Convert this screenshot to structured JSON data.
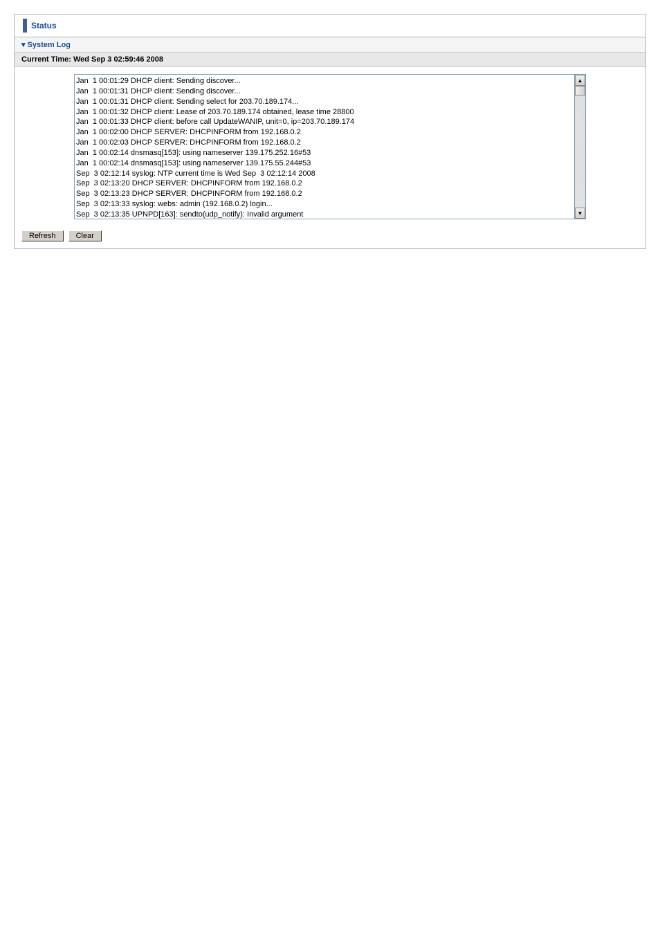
{
  "header": {
    "title": "Status"
  },
  "section": {
    "system_log_label": "System Log",
    "current_time_label": "Current Time:",
    "current_time_value": "Wed Sep 3 02:59:46 2008"
  },
  "log_lines": [
    "Jan  1 00:01:29 DHCP client: Sending discover...",
    "Jan  1 00:01:31 DHCP client: Sending discover...",
    "Jan  1 00:01:31 DHCP client: Sending select for 203.70.189.174...",
    "Jan  1 00:01:32 DHCP client: Lease of 203.70.189.174 obtained, lease time 28800",
    "Jan  1 00:01:33 DHCP client: before call UpdateWANIP, unit=0, ip=203.70.189.174",
    "Jan  1 00:02:00 DHCP SERVER: DHCPINFORM from 192.168.0.2",
    "Jan  1 00:02:03 DHCP SERVER: DHCPINFORM from 192.168.0.2",
    "Jan  1 00:02:14 dnsmasq[153]: using nameserver 139.175.252.16#53",
    "Jan  1 00:02:14 dnsmasq[153]: using nameserver 139.175.55.244#53",
    "Sep  3 02:12:14 syslog: NTP current time is Wed Sep  3 02:12:14 2008",
    "Sep  3 02:13:20 DHCP SERVER: DHCPINFORM from 192.168.0.2",
    "Sep  3 02:13:23 DHCP SERVER: DHCPINFORM from 192.168.0.2",
    "Sep  3 02:13:33 syslog: webs: admin (192.168.0.2) login...",
    "Sep  3 02:13:35 UPNPD[163]: sendto(udp_notify): Invalid argument"
  ],
  "buttons": {
    "refresh": "Refresh",
    "clear": "Clear"
  }
}
